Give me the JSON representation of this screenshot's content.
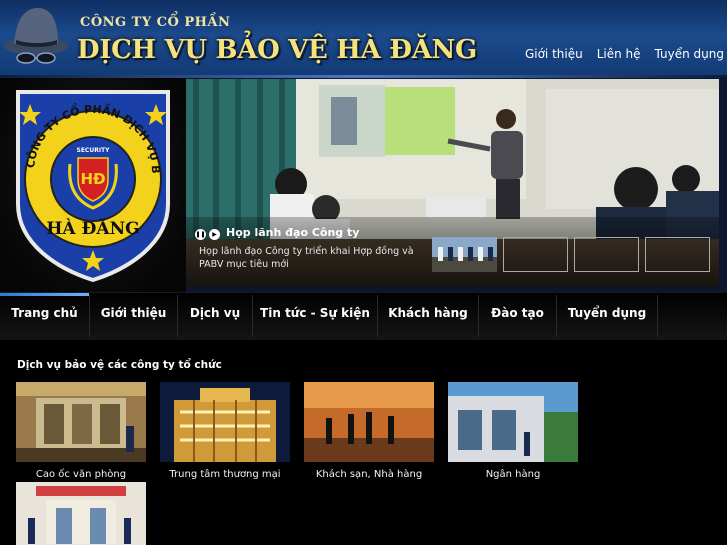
{
  "header": {
    "company_prefix": "CÔNG TY CỔ PHẦN",
    "company_name": "DỊCH VỤ BẢO VỆ HÀ ĐĂNG",
    "top_nav": [
      "Giới thiệu",
      "Liên hệ",
      "Tuyển dụng"
    ]
  },
  "logo": {
    "ring_text": "CÔNG TY CỔ PHẦN DỊCH VỤ BẢO VỆ",
    "name": "HÀ ĐĂNG",
    "badge_text": "SECURITY",
    "monogram": "HĐ"
  },
  "slideshow": {
    "title": "Họp lãnh đạo Công ty",
    "description": "Họp lãnh đạo Công ty triển khai Hợp đồng và PABV mục tiêu mới",
    "thumbnail_count": 4
  },
  "main_nav": [
    "Trang chủ",
    "Giới thiệu",
    "Dịch vụ",
    "Tin tức - Sự kiện",
    "Khách hàng",
    "Đào tạo",
    "Tuyển dụng"
  ],
  "section": {
    "title": "Dịch vụ bảo vệ các công ty tổ chức",
    "cards": [
      {
        "label": "Cao ốc văn phòng"
      },
      {
        "label": "Trung tâm thương mại"
      },
      {
        "label": "Khách sạn, Nhà hàng"
      },
      {
        "label": "Ngân hàng"
      },
      {
        "label": ""
      }
    ]
  },
  "colors": {
    "header_blue": "#1c4a8c",
    "title_gold": "#f6e27a",
    "logo_yellow": "#f2d21a",
    "logo_blue": "#1a3fa8",
    "nav_active": "#3b8ce8"
  }
}
